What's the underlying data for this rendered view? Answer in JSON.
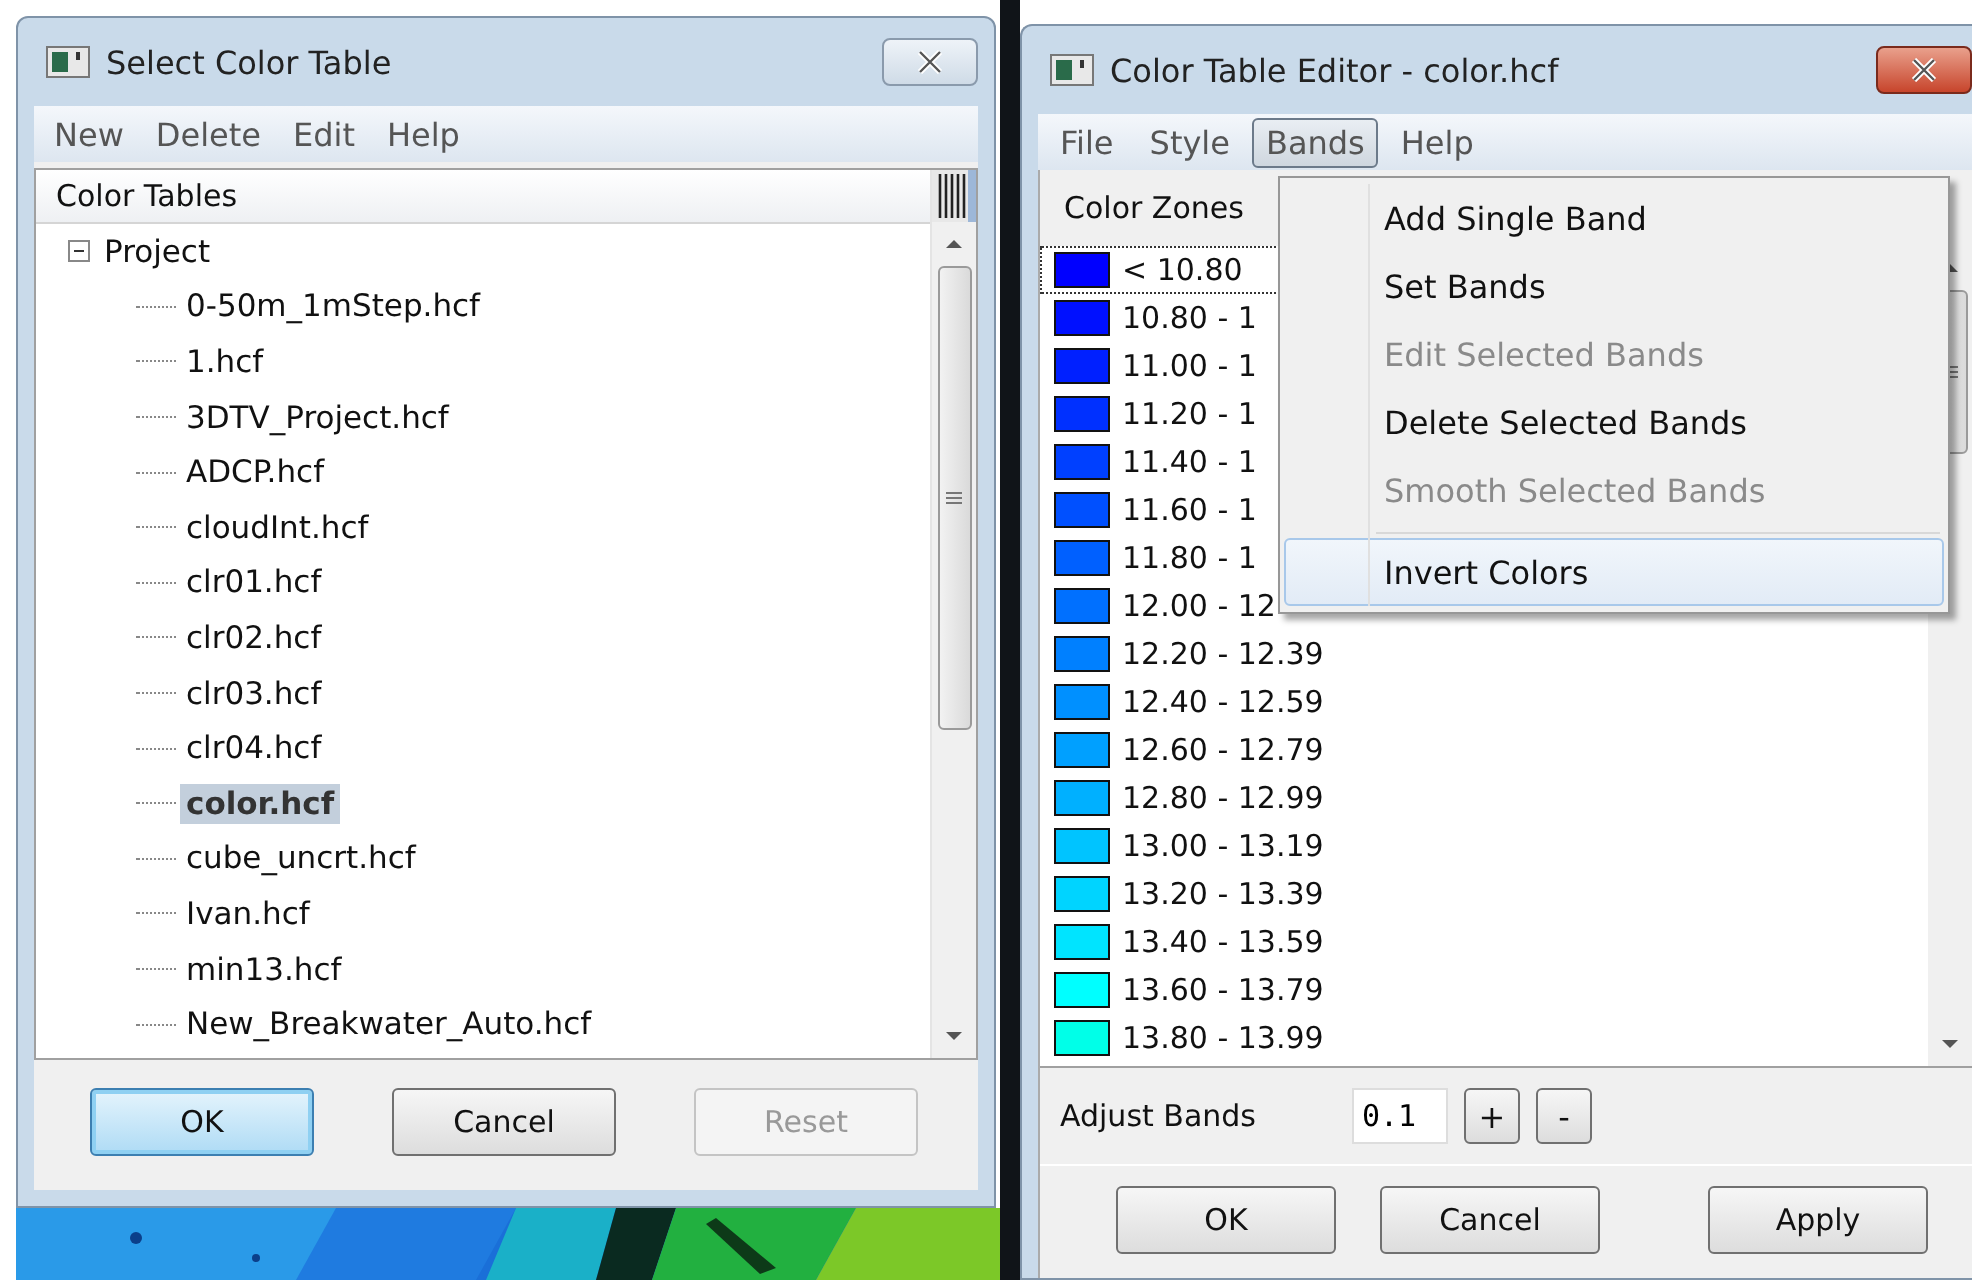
{
  "select_window": {
    "title": "Select Color Table",
    "menu": [
      "New",
      "Delete",
      "Edit",
      "Help"
    ],
    "tree": {
      "header": "Color Tables",
      "items": [
        {
          "label": "Project",
          "expanded": true,
          "selected": false,
          "children": [
            {
              "label": "0-50m_1mStep.hcf",
              "selected": false
            },
            {
              "label": "1.hcf",
              "selected": false
            },
            {
              "label": "3DTV_Project.hcf",
              "selected": false
            },
            {
              "label": "ADCP.hcf",
              "selected": false
            },
            {
              "label": "cloudInt.hcf",
              "selected": false
            },
            {
              "label": "clr01.hcf",
              "selected": false
            },
            {
              "label": "clr02.hcf",
              "selected": false
            },
            {
              "label": "clr03.hcf",
              "selected": false
            },
            {
              "label": "clr04.hcf",
              "selected": false
            },
            {
              "label": "color.hcf",
              "selected": true
            },
            {
              "label": "cube_uncrt.hcf",
              "selected": false
            },
            {
              "label": "Ivan.hcf",
              "selected": false
            },
            {
              "label": "min13.hcf",
              "selected": false
            },
            {
              "label": "New_Breakwater_Auto.hcf",
              "selected": false
            }
          ]
        }
      ]
    },
    "buttons": [
      {
        "label": "OK",
        "default": true,
        "disabled": false
      },
      {
        "label": "Cancel",
        "default": false,
        "disabled": false
      },
      {
        "label": "Reset",
        "default": false,
        "disabled": true
      }
    ]
  },
  "editor_window": {
    "title": "Color Table Editor - color.hcf",
    "menu": [
      {
        "label": "File",
        "selected": false
      },
      {
        "label": "Style",
        "selected": false
      },
      {
        "label": "Bands",
        "selected": true
      },
      {
        "label": "Help",
        "selected": false
      }
    ],
    "zones_header": "Color Zones",
    "zones": [
      {
        "label": "< 10.80",
        "color": "#0000ff",
        "selected": true
      },
      {
        "label": "10.80 - 1",
        "color": "#0010ff",
        "selected": false
      },
      {
        "label": "11.00 - 1",
        "color": "#0020ff",
        "selected": false
      },
      {
        "label": "11.20 - 1",
        "color": "#0030ff",
        "selected": false
      },
      {
        "label": "11.40 - 1",
        "color": "#0040ff",
        "selected": false
      },
      {
        "label": "11.60 - 1",
        "color": "#0050ff",
        "selected": false
      },
      {
        "label": "11.80 - 1",
        "color": "#0060ff",
        "selected": false
      },
      {
        "label": "12.00 - 12",
        "color": "#0070ff",
        "selected": false
      },
      {
        "label": "12.20 - 12.39",
        "color": "#0080ff",
        "selected": false
      },
      {
        "label": "12.40 - 12.59",
        "color": "#0090ff",
        "selected": false
      },
      {
        "label": "12.60 - 12.79",
        "color": "#00a0ff",
        "selected": false
      },
      {
        "label": "12.80 - 12.99",
        "color": "#00b0ff",
        "selected": false
      },
      {
        "label": "13.00 - 13.19",
        "color": "#00c4ff",
        "selected": false
      },
      {
        "label": "13.20 - 13.39",
        "color": "#00d4ff",
        "selected": false
      },
      {
        "label": "13.40 - 13.59",
        "color": "#00e4ff",
        "selected": false
      },
      {
        "label": "13.60 - 13.79",
        "color": "#00ffff",
        "selected": false
      },
      {
        "label": "13.80 - 13.99",
        "color": "#00ffe8",
        "selected": false
      }
    ],
    "bands_menu": [
      {
        "kind": "item",
        "label": "Add Single Band",
        "disabled": false,
        "selected": false
      },
      {
        "kind": "item",
        "label": "Set Bands",
        "disabled": false,
        "selected": false
      },
      {
        "kind": "item",
        "label": "Edit Selected Bands",
        "disabled": true,
        "selected": false
      },
      {
        "kind": "item",
        "label": "Delete Selected Bands",
        "disabled": false,
        "selected": false
      },
      {
        "kind": "item",
        "label": "Smooth Selected Bands",
        "disabled": true,
        "selected": false
      },
      {
        "kind": "separator"
      },
      {
        "kind": "item",
        "label": "Invert Colors",
        "disabled": false,
        "selected": true
      }
    ],
    "adjust": {
      "label": "Adjust Bands",
      "value": "0.1",
      "increase": "+",
      "decrease": "-"
    },
    "buttons": [
      {
        "label": "OK"
      },
      {
        "label": "Cancel"
      },
      {
        "label": "Apply"
      }
    ]
  }
}
